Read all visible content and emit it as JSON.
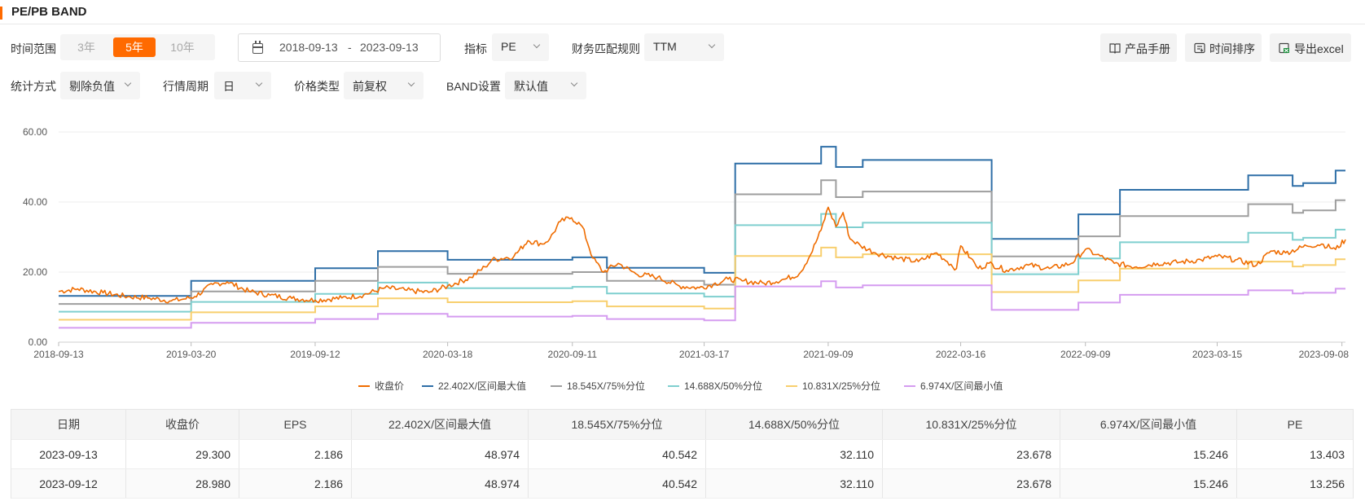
{
  "header": {
    "title": "PE/PB BAND"
  },
  "filters": {
    "time_range_label": "时间范围",
    "time_range_options": [
      "3年",
      "5年",
      "10年"
    ],
    "date_start": "2018-09-13",
    "date_sep": "-",
    "date_end": "2023-09-13",
    "indicator_label": "指标",
    "indicator_value": "PE",
    "finance_rule_label": "财务匹配规则",
    "finance_rule_value": "TTM",
    "stat_method_label": "统计方式",
    "stat_method_value": "剔除负值",
    "period_label": "行情周期",
    "period_value": "日",
    "price_type_label": "价格类型",
    "price_type_value": "前复权",
    "band_label": "BAND设置",
    "band_value": "默认值"
  },
  "toolbar": {
    "manual": "产品手册",
    "sort": "时间排序",
    "export": "导出excel"
  },
  "colors": {
    "accent": "#ff6a00",
    "close": "#ef6c00",
    "max": "#2f6fa7",
    "p75": "#9e9e9e",
    "p50": "#7fcfcf",
    "p25": "#f8cf6e",
    "min": "#d59cf0"
  },
  "chart_data": {
    "type": "line",
    "ylim": [
      0,
      60
    ],
    "yticks": [
      "0.00",
      "20.00",
      "40.00",
      "60.00"
    ],
    "xticks": [
      "2018-09-13",
      "2019-03-20",
      "2019-09-12",
      "2020-03-18",
      "2020-09-11",
      "2021-03-17",
      "2021-09-09",
      "2022-03-16",
      "2022-09-09",
      "2023-03-15",
      "2023-09-08"
    ],
    "x_domain": [
      "2018-09-13",
      "2023-09-13"
    ],
    "grid": "horizontal",
    "legend_position": "bottom",
    "bands": [
      {
        "name": "22.402X/区间最大值",
        "color": "#2f6fa7",
        "points": [
          [
            "2018-09-13",
            13.2
          ],
          [
            "2019-03-20",
            17.5
          ],
          [
            "2019-09-12",
            21.1
          ],
          [
            "2019-12-10",
            26.0
          ],
          [
            "2020-03-18",
            23.5
          ],
          [
            "2020-09-11",
            24.2
          ],
          [
            "2020-10-30",
            21.2
          ],
          [
            "2021-03-17",
            19.8
          ],
          [
            "2021-04-30",
            51.0
          ],
          [
            "2021-08-30",
            55.8
          ],
          [
            "2021-09-20",
            50.0
          ],
          [
            "2021-10-28",
            52.0
          ],
          [
            "2022-04-29",
            29.5
          ],
          [
            "2022-08-30",
            36.5
          ],
          [
            "2022-10-28",
            43.5
          ],
          [
            "2023-04-28",
            47.6
          ],
          [
            "2023-06-30",
            44.6
          ],
          [
            "2023-07-15",
            45.4
          ],
          [
            "2023-08-30",
            48.97
          ],
          [
            "2023-09-13",
            48.97
          ]
        ]
      },
      {
        "name": "18.545X/75%分位",
        "color": "#9e9e9e",
        "points": [
          [
            "2018-09-13",
            10.9
          ],
          [
            "2019-03-20",
            14.5
          ],
          [
            "2019-09-12",
            17.5
          ],
          [
            "2019-12-10",
            21.5
          ],
          [
            "2020-03-18",
            19.5
          ],
          [
            "2020-09-11",
            20.0
          ],
          [
            "2020-10-30",
            17.5
          ],
          [
            "2021-03-17",
            16.4
          ],
          [
            "2021-04-30",
            42.2
          ],
          [
            "2021-08-30",
            46.2
          ],
          [
            "2021-09-20",
            41.4
          ],
          [
            "2021-10-28",
            43.0
          ],
          [
            "2022-04-29",
            24.5
          ],
          [
            "2022-08-30",
            30.2
          ],
          [
            "2022-10-28",
            36.0
          ],
          [
            "2023-04-28",
            39.4
          ],
          [
            "2023-06-30",
            36.9
          ],
          [
            "2023-07-15",
            37.6
          ],
          [
            "2023-08-30",
            40.54
          ],
          [
            "2023-09-13",
            40.54
          ]
        ]
      },
      {
        "name": "14.688X/50%分位",
        "color": "#7fcfcf",
        "points": [
          [
            "2018-09-13",
            8.7
          ],
          [
            "2019-03-20",
            11.5
          ],
          [
            "2019-09-12",
            13.8
          ],
          [
            "2019-12-10",
            17.0
          ],
          [
            "2020-03-18",
            15.4
          ],
          [
            "2020-09-11",
            15.8
          ],
          [
            "2020-10-30",
            13.9
          ],
          [
            "2021-03-17",
            13.0
          ],
          [
            "2021-04-30",
            33.4
          ],
          [
            "2021-08-30",
            36.6
          ],
          [
            "2021-09-20",
            32.8
          ],
          [
            "2021-10-28",
            34.1
          ],
          [
            "2022-04-29",
            19.4
          ],
          [
            "2022-08-30",
            23.9
          ],
          [
            "2022-10-28",
            28.5
          ],
          [
            "2023-04-28",
            31.2
          ],
          [
            "2023-06-30",
            29.2
          ],
          [
            "2023-07-15",
            29.8
          ],
          [
            "2023-08-30",
            32.11
          ],
          [
            "2023-09-13",
            32.11
          ]
        ]
      },
      {
        "name": "10.831X/25%分位",
        "color": "#f8cf6e",
        "points": [
          [
            "2018-09-13",
            6.4
          ],
          [
            "2019-03-20",
            8.5
          ],
          [
            "2019-09-12",
            10.2
          ],
          [
            "2019-12-10",
            12.5
          ],
          [
            "2020-03-18",
            11.4
          ],
          [
            "2020-09-11",
            11.7
          ],
          [
            "2020-10-30",
            10.2
          ],
          [
            "2021-03-17",
            9.6
          ],
          [
            "2021-04-30",
            24.6
          ],
          [
            "2021-08-30",
            27.0
          ],
          [
            "2021-09-20",
            24.2
          ],
          [
            "2021-10-28",
            25.1
          ],
          [
            "2022-04-29",
            14.3
          ],
          [
            "2022-08-30",
            17.6
          ],
          [
            "2022-10-28",
            21.0
          ],
          [
            "2023-04-28",
            23.0
          ],
          [
            "2023-06-30",
            21.6
          ],
          [
            "2023-07-15",
            22.0
          ],
          [
            "2023-08-30",
            23.68
          ],
          [
            "2023-09-13",
            23.68
          ]
        ]
      },
      {
        "name": "6.974X/区间最小值",
        "color": "#d59cf0",
        "points": [
          [
            "2018-09-13",
            4.1
          ],
          [
            "2019-03-20",
            5.5
          ],
          [
            "2019-09-12",
            6.6
          ],
          [
            "2019-12-10",
            8.1
          ],
          [
            "2020-03-18",
            7.3
          ],
          [
            "2020-09-11",
            7.5
          ],
          [
            "2020-10-30",
            6.6
          ],
          [
            "2021-03-17",
            6.2
          ],
          [
            "2021-04-30",
            15.9
          ],
          [
            "2021-08-30",
            17.4
          ],
          [
            "2021-09-20",
            15.6
          ],
          [
            "2021-10-28",
            16.2
          ],
          [
            "2022-04-29",
            9.2
          ],
          [
            "2022-08-30",
            11.3
          ],
          [
            "2022-10-28",
            13.5
          ],
          [
            "2023-04-28",
            14.8
          ],
          [
            "2023-06-30",
            13.9
          ],
          [
            "2023-07-15",
            14.1
          ],
          [
            "2023-08-30",
            15.25
          ],
          [
            "2023-09-13",
            15.25
          ]
        ]
      }
    ],
    "close_series": {
      "name": "收盘价",
      "color": "#ef6c00",
      "points": [
        [
          "2018-09-13",
          14.5
        ],
        [
          "2018-10-10",
          15.2
        ],
        [
          "2018-11-15",
          14.1
        ],
        [
          "2018-12-20",
          13.0
        ],
        [
          "2019-01-20",
          12.6
        ],
        [
          "2019-02-20",
          11.8
        ],
        [
          "2019-03-10",
          12.3
        ],
        [
          "2019-03-25",
          13.0
        ],
        [
          "2019-04-20",
          16.5
        ],
        [
          "2019-05-10",
          17.2
        ],
        [
          "2019-06-10",
          14.5
        ],
        [
          "2019-07-10",
          13.4
        ],
        [
          "2019-08-10",
          12.5
        ],
        [
          "2019-09-12",
          12.0
        ],
        [
          "2019-10-20",
          12.6
        ],
        [
          "2019-11-20",
          13.5
        ],
        [
          "2019-12-20",
          15.5
        ],
        [
          "2020-01-20",
          14.8
        ],
        [
          "2020-02-20",
          14.2
        ],
        [
          "2020-03-18",
          16.0
        ],
        [
          "2020-04-20",
          18.5
        ],
        [
          "2020-05-10",
          21.5
        ],
        [
          "2020-05-20",
          23.5
        ],
        [
          "2020-06-20",
          24.5
        ],
        [
          "2020-07-10",
          29.0
        ],
        [
          "2020-07-30",
          28.0
        ],
        [
          "2020-08-10",
          29.5
        ],
        [
          "2020-08-25",
          34.5
        ],
        [
          "2020-09-10",
          35.5
        ],
        [
          "2020-09-25",
          33.0
        ],
        [
          "2020-10-10",
          24.0
        ],
        [
          "2020-10-25",
          20.0
        ],
        [
          "2020-11-15",
          22.5
        ],
        [
          "2020-12-10",
          19.5
        ],
        [
          "2021-01-10",
          18.5
        ],
        [
          "2021-02-10",
          16.0
        ],
        [
          "2021-03-10",
          15.5
        ],
        [
          "2021-03-30",
          16.5
        ],
        [
          "2021-04-20",
          18.0
        ],
        [
          "2021-05-10",
          17.5
        ],
        [
          "2021-06-10",
          16.8
        ],
        [
          "2021-07-10",
          18.0
        ],
        [
          "2021-07-30",
          19.5
        ],
        [
          "2021-08-15",
          25.0
        ],
        [
          "2021-08-30",
          32.0
        ],
        [
          "2021-09-09",
          38.5
        ],
        [
          "2021-09-20",
          33.0
        ],
        [
          "2021-09-30",
          37.0
        ],
        [
          "2021-10-10",
          29.5
        ],
        [
          "2021-10-25",
          27.5
        ],
        [
          "2021-11-15",
          25.5
        ],
        [
          "2021-12-15",
          24.0
        ],
        [
          "2022-01-15",
          23.0
        ],
        [
          "2022-02-10",
          25.5
        ],
        [
          "2022-02-25",
          23.0
        ],
        [
          "2022-03-10",
          21.0
        ],
        [
          "2022-03-16",
          27.5
        ],
        [
          "2022-03-30",
          24.0
        ],
        [
          "2022-04-10",
          21.0
        ],
        [
          "2022-04-25",
          22.5
        ],
        [
          "2022-05-20",
          20.5
        ],
        [
          "2022-06-20",
          22.0
        ],
        [
          "2022-07-20",
          21.0
        ],
        [
          "2022-08-20",
          22.5
        ],
        [
          "2022-09-09",
          26.5
        ],
        [
          "2022-09-25",
          25.0
        ],
        [
          "2022-10-20",
          22.5
        ],
        [
          "2022-11-20",
          21.5
        ],
        [
          "2022-12-20",
          22.5
        ],
        [
          "2023-01-20",
          22.8
        ],
        [
          "2023-02-20",
          23.5
        ],
        [
          "2023-03-15",
          24.5
        ],
        [
          "2023-04-10",
          23.5
        ],
        [
          "2023-05-10",
          22.0
        ],
        [
          "2023-05-30",
          26.0
        ],
        [
          "2023-06-20",
          25.5
        ],
        [
          "2023-07-20",
          27.5
        ],
        [
          "2023-08-10",
          28.0
        ],
        [
          "2023-08-30",
          26.5
        ],
        [
          "2023-09-13",
          29.3
        ]
      ]
    }
  },
  "legend": [
    "收盘价",
    "22.402X/区间最大值",
    "18.545X/75%分位",
    "14.688X/50%分位",
    "10.831X/25%分位",
    "6.974X/区间最小值"
  ],
  "table": {
    "headers": [
      "日期",
      "收盘价",
      "EPS",
      "22.402X/区间最大值",
      "18.545X/75%分位",
      "14.688X/50%分位",
      "10.831X/25%分位",
      "6.974X/区间最小值",
      "PE"
    ],
    "rows": [
      [
        "2023-09-13",
        "29.300",
        "2.186",
        "48.974",
        "40.542",
        "32.110",
        "23.678",
        "15.246",
        "13.403"
      ],
      [
        "2023-09-12",
        "28.980",
        "2.186",
        "48.974",
        "40.542",
        "32.110",
        "23.678",
        "15.246",
        "13.256"
      ]
    ]
  }
}
